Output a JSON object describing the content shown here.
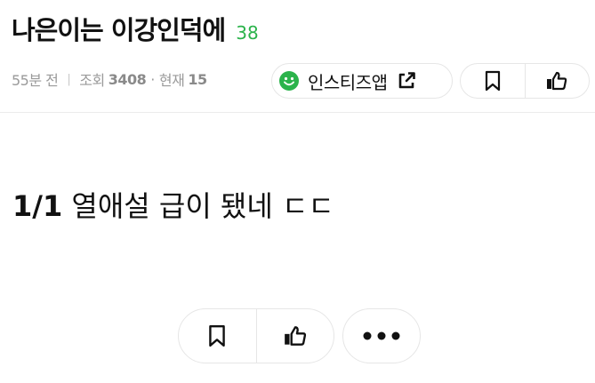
{
  "post": {
    "title": "나은이는 이강인덕에",
    "comment_count": "38",
    "meta": {
      "time_ago": "55분 전",
      "views_label": "조회",
      "views": "3408",
      "current_label": "현재",
      "current": "15"
    },
    "app_link_label": "인스티즈앱",
    "body_prefix": "1/1",
    "body": "열애설 급이 됐네 ㄷㄷ"
  },
  "colors": {
    "accent_green": "#2bb34b",
    "meta_gray": "#9a9a9a",
    "border": "#e6e6e6"
  },
  "icons": [
    "smile-icon",
    "external-link-icon",
    "bookmark-icon",
    "thumbs-up-icon",
    "more-icon"
  ]
}
